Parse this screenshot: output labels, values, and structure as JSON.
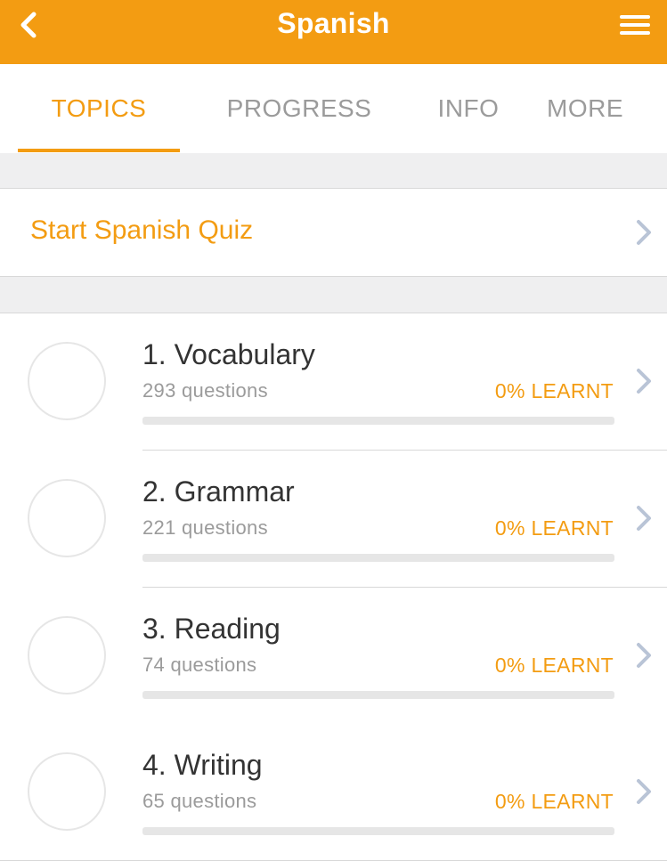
{
  "header": {
    "title": "Spanish",
    "back_icon": "chevron-left-icon",
    "menu_icon": "hamburger-menu-icon"
  },
  "tabs": [
    {
      "label": "TOPICS",
      "active": true
    },
    {
      "label": "PROGRESS",
      "active": false
    },
    {
      "label": "INFO",
      "active": false
    },
    {
      "label": "MORE",
      "active": false
    }
  ],
  "quiz": {
    "label": "Start Spanish Quiz"
  },
  "topics": [
    {
      "title": "1. Vocabulary",
      "questions": "293 questions",
      "learnt": "0% LEARNT",
      "progress": 0
    },
    {
      "title": "2. Grammar",
      "questions": "221 questions",
      "learnt": "0% LEARNT",
      "progress": 0
    },
    {
      "title": "3. Reading",
      "questions": "74 questions",
      "learnt": "0% LEARNT",
      "progress": 0
    },
    {
      "title": "4. Writing",
      "questions": "65 questions",
      "learnt": "0% LEARNT",
      "progress": 0
    }
  ],
  "colors": {
    "accent": "#f39c12",
    "muted": "#9b9b9b",
    "text": "#333333",
    "chevron": "#b9c4d6"
  }
}
